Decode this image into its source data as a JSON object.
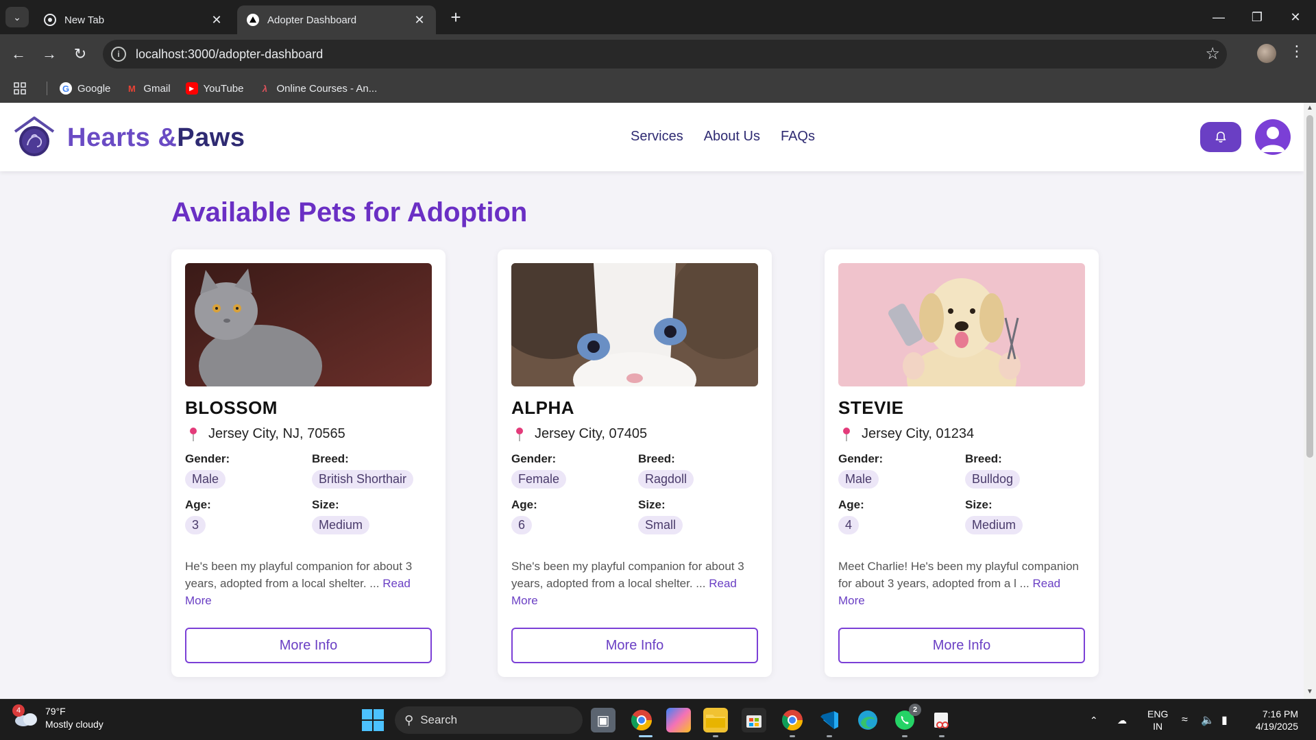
{
  "browser": {
    "tabs": [
      {
        "title": "New Tab",
        "active": false
      },
      {
        "title": "Adopter Dashboard",
        "active": true
      }
    ],
    "url": "localhost:3000/adopter-dashboard",
    "bookmarks": [
      {
        "label": "Google"
      },
      {
        "label": "Gmail"
      },
      {
        "label": "YouTube"
      },
      {
        "label": "Online Courses - An..."
      }
    ]
  },
  "site": {
    "brand_part1": "Hearts &",
    "brand_part2": "Paws",
    "nav": [
      "Services",
      "About Us",
      "FAQs"
    ]
  },
  "page": {
    "title": "Available Pets for Adoption"
  },
  "labels": {
    "gender": "Gender:",
    "breed": "Breed:",
    "age": "Age:",
    "size": "Size:",
    "read_more": "Read More",
    "more_info": "More Info"
  },
  "pets": [
    {
      "name": "BLOSSOM",
      "location": "Jersey City, NJ, 70565",
      "gender": "Male",
      "breed": "British Shorthair",
      "age": "3",
      "size": "Medium",
      "description": "He's been my playful companion for about 3 years, adopted from a local shelter.  ..."
    },
    {
      "name": "ALPHA",
      "location": "Jersey City, 07405",
      "gender": "Female",
      "breed": "Ragdoll",
      "age": "6",
      "size": "Small",
      "description": "She's been my playful companion for about 3 years, adopted from a local shelter. ..."
    },
    {
      "name": "STEVIE",
      "location": "Jersey City, 01234",
      "gender": "Male",
      "breed": "Bulldog",
      "age": "4",
      "size": "Medium",
      "description": "Meet Charlie! He's been my playful companion for about 3 years, adopted from a l ..."
    }
  ],
  "taskbar": {
    "weather_temp": "79°F",
    "weather_desc": "Mostly cloudy",
    "weather_badge": "4",
    "search_placeholder": "Search",
    "whatsapp_badge": "2",
    "lang_line1": "ENG",
    "lang_line2": "IN",
    "time": "7:16 PM",
    "date": "4/19/2025"
  },
  "colors": {
    "brand_purple": "#6a3fc4",
    "brand_navy": "#2e2a72",
    "chip_bg": "#ece6f7"
  }
}
